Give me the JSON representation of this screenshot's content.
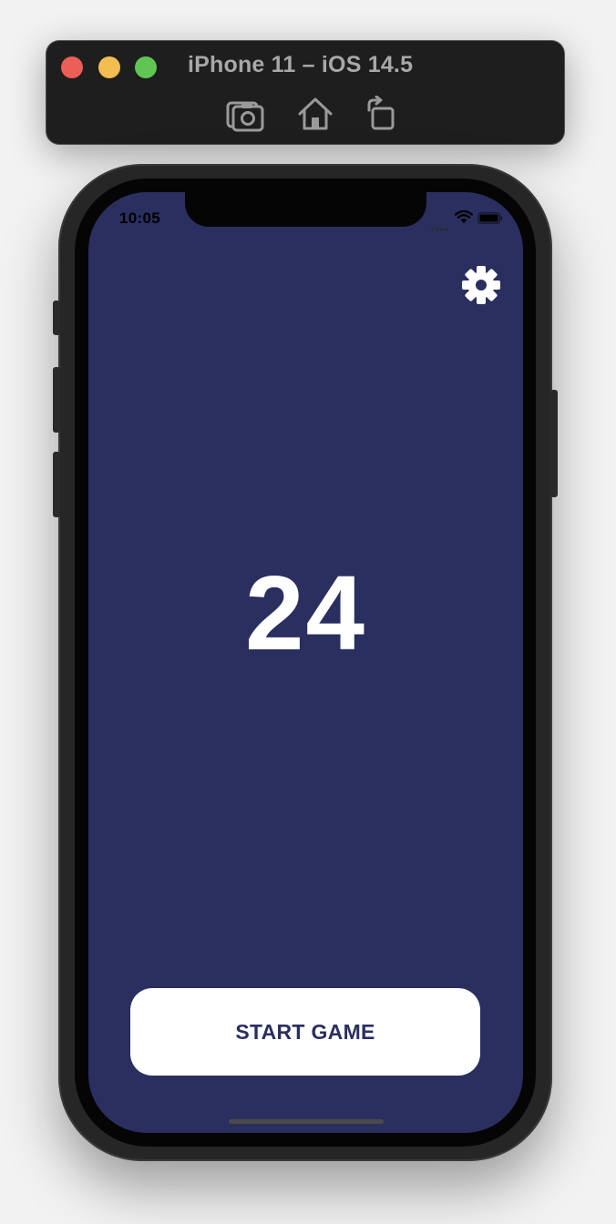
{
  "simulator": {
    "title": "iPhone 11 – iOS 14.5",
    "toolbar_icons": [
      "screenshot-icon",
      "home-icon",
      "rotate-icon"
    ],
    "traffic_lights": {
      "close": "#ec5f57",
      "minimize": "#f4bd4f",
      "zoom": "#61c554"
    }
  },
  "status_bar": {
    "time": "10:05",
    "icons": [
      "signal-icon",
      "wifi-icon",
      "battery-icon"
    ]
  },
  "app": {
    "background_color": "#2a2f60",
    "settings_icon": "gear-icon",
    "counter_value": "24",
    "start_button_label": "START GAME"
  }
}
